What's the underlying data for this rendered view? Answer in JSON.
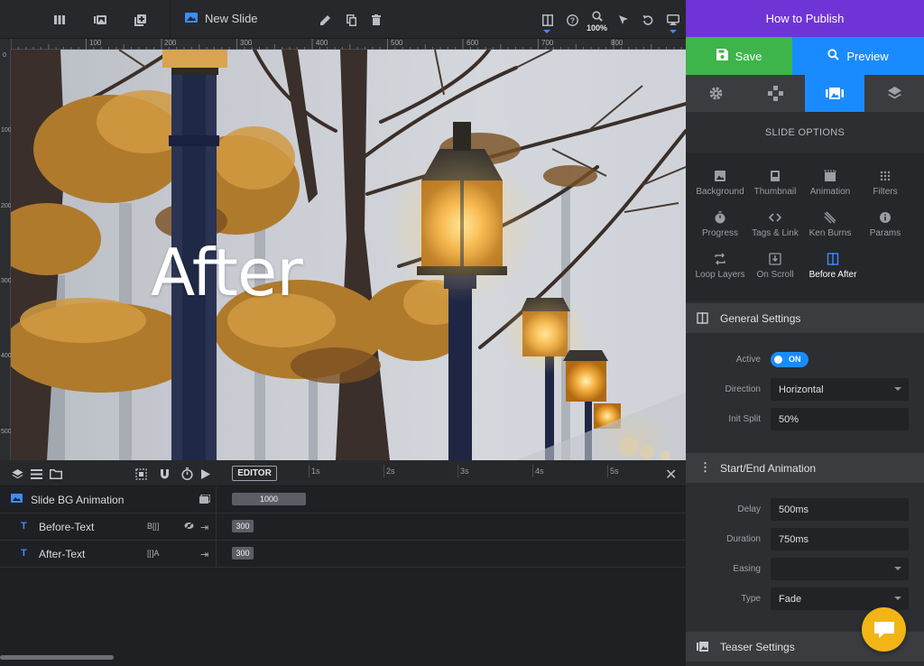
{
  "toolbar": {
    "slide_title": "New Slide",
    "zoom": "100%",
    "icons": [
      "layout-icon",
      "slides-icon",
      "add-slide-icon",
      "slide-icon",
      "edit-icon",
      "duplicate-icon",
      "trash-icon",
      "before-after-icon",
      "help-icon",
      "zoom-icon",
      "cursor-icon",
      "undo-icon",
      "monitor-icon"
    ]
  },
  "ruler": {
    "h_labels": [
      "100",
      "200",
      "300",
      "400",
      "500",
      "600",
      "700",
      "800"
    ],
    "v_labels": [
      "0",
      "100",
      "200",
      "300",
      "400",
      "500"
    ]
  },
  "canvas": {
    "overlay_text": "After"
  },
  "timeline": {
    "editor_label": "EDITOR",
    "ticks": [
      "1s",
      "2s",
      "3s",
      "4s",
      "5s"
    ],
    "rows": [
      {
        "label": "Slide BG Animation",
        "bar_value": "1000"
      },
      {
        "label": "Before-Text",
        "tag": "B[|]",
        "bar_value": "300"
      },
      {
        "label": "After-Text",
        "tag": "[|]A",
        "bar_value": "300"
      }
    ]
  },
  "panel": {
    "header": "How to Publish",
    "save_label": "Save",
    "preview_label": "Preview",
    "tabs": [
      "settings-tab",
      "navigation-tab",
      "slides-tab",
      "layers-tab"
    ],
    "slide_options_title": "SLIDE OPTIONS",
    "options": [
      {
        "label": "Background",
        "icon": "image-icon"
      },
      {
        "label": "Thumbnail",
        "icon": "thumbnail-icon"
      },
      {
        "label": "Animation",
        "icon": "film-icon"
      },
      {
        "label": "Filters",
        "icon": "filters-icon"
      },
      {
        "label": "Progress",
        "icon": "timer-icon"
      },
      {
        "label": "Tags & Link",
        "icon": "code-icon"
      },
      {
        "label": "Ken Burns",
        "icon": "kenburns-icon"
      },
      {
        "label": "Params",
        "icon": "info-icon"
      },
      {
        "label": "Loop Layers",
        "icon": "loop-icon"
      },
      {
        "label": "On Scroll",
        "icon": "download-icon"
      },
      {
        "label": "Before After",
        "icon": "before-after-icon",
        "active": true
      }
    ],
    "general": {
      "title": "General Settings",
      "active_label": "Active",
      "active_value": "ON",
      "direction_label": "Direction",
      "direction_value": "Horizontal",
      "init_split_label": "Init Split",
      "init_split_value": "50%"
    },
    "start_end": {
      "title": "Start/End Animation",
      "delay_label": "Delay",
      "delay_value": "500ms",
      "duration_label": "Duration",
      "duration_value": "750ms",
      "easing_label": "Easing",
      "easing_value": "",
      "type_label": "Type",
      "type_value": "Fade"
    },
    "teaser": {
      "title": "Teaser Settings"
    }
  },
  "colors": {
    "accent": "#1a8bff",
    "save": "#3db54a",
    "header": "#6f34d6",
    "chat": "#f2b515"
  }
}
